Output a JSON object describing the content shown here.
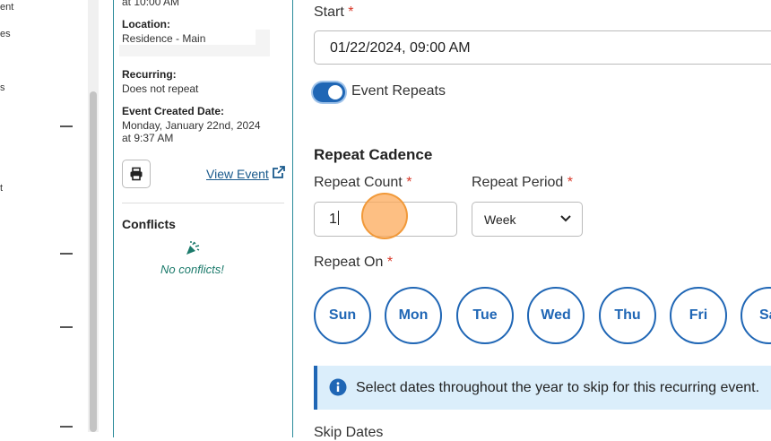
{
  "nav": {
    "items": [
      {
        "text": "ent"
      },
      {
        "text": "es"
      },
      {
        "text": "s"
      },
      {
        "text": "t"
      }
    ]
  },
  "event_panel": {
    "time_fragment": "at 10:00 AM",
    "location_label": "Location:",
    "location_value": "Residence - Main",
    "recurring_label": "Recurring:",
    "recurring_value": "Does not repeat",
    "created_label": "Event Created Date:",
    "created_value_line1": "Monday, January 22nd, 2024",
    "created_value_line2": "at 9:37 AM",
    "view_event_link": "View Event",
    "conflicts_title": "Conflicts",
    "no_conflicts_text": "No conflicts!"
  },
  "form": {
    "start_label": "Start",
    "start_value": "01/22/2024, 09:00 AM",
    "event_repeats_label": "Event Repeats",
    "event_repeats_on": true,
    "repeat_cadence_title": "Repeat Cadence",
    "repeat_count_label": "Repeat Count",
    "repeat_count_value": "1",
    "repeat_period_label": "Repeat Period",
    "repeat_period_value": "Week",
    "repeat_on_label": "Repeat On",
    "days": [
      "Sun",
      "Mon",
      "Tue",
      "Wed",
      "Thu",
      "Fri",
      "Sa"
    ],
    "info_text": "Select dates throughout the year to skip for this recurring event.",
    "skip_dates_label": "Skip Dates",
    "required_marker": "*"
  },
  "colors": {
    "accent": "#1f66b5",
    "panel_border": "#2a8a9a",
    "required": "#d93a2b",
    "info_bg": "#dbeefb",
    "success_text": "#1b7a6b"
  }
}
